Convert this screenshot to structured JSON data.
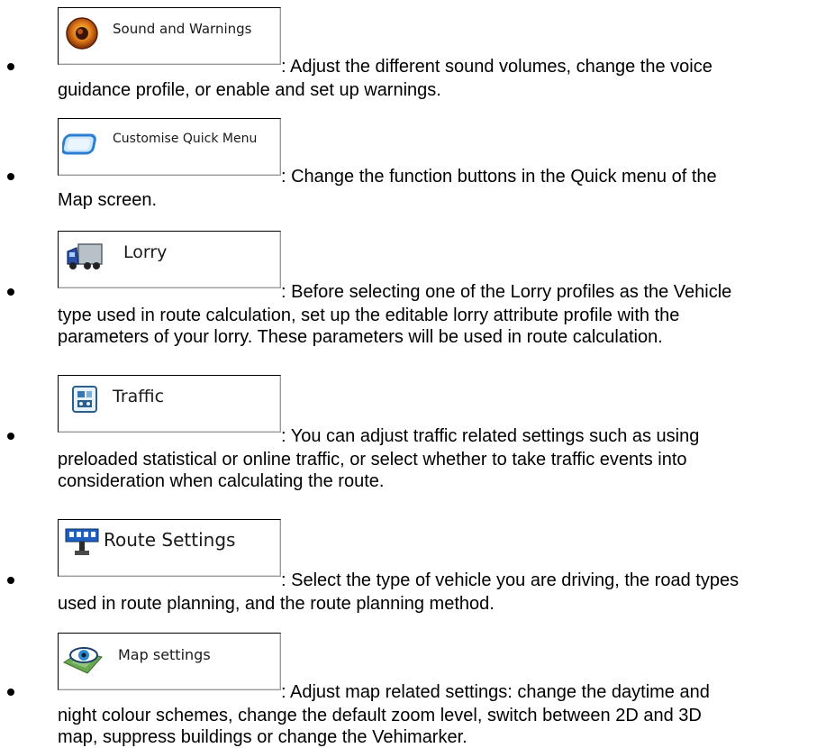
{
  "items": [
    {
      "button_label": "Sound and Warnings",
      "icon": "speaker-icon",
      "lines": [
        ": Adjust the different sound volumes, change the voice",
        "guidance profile, or enable and set up warnings."
      ]
    },
    {
      "button_label": "Customise Quick Menu",
      "icon": "quick-menu-icon",
      "lines": [
        ": Change the function buttons in the Quick menu of the",
        "Map screen."
      ]
    },
    {
      "button_label": "Lorry",
      "icon": "lorry-icon",
      "lines": [
        ": Before selecting one of the Lorry profiles as the Vehicle",
        "type used in route calculation, set up the editable lorry attribute profile with the",
        "parameters of your lorry. These parameters will be used in route calculation."
      ]
    },
    {
      "button_label": "Traffic",
      "icon": "traffic-icon",
      "lines": [
        ": You can adjust traffic related settings such as using",
        "preloaded statistical or online traffic, or select whether to take traffic events into",
        "consideration when calculating the route."
      ]
    },
    {
      "button_label": "Route Settings",
      "icon": "route-sign-icon",
      "lines": [
        ": Select the type of vehicle you are driving, the road types",
        "used in route planning, and the route planning method."
      ]
    },
    {
      "button_label": "Map settings",
      "icon": "eye-map-icon",
      "lines": [
        ": Adjust map related settings: change the daytime and",
        "night colour schemes, change the default zoom level, switch between 2D and 3D",
        "map, suppress buildings or change the Vehimarker."
      ]
    }
  ]
}
